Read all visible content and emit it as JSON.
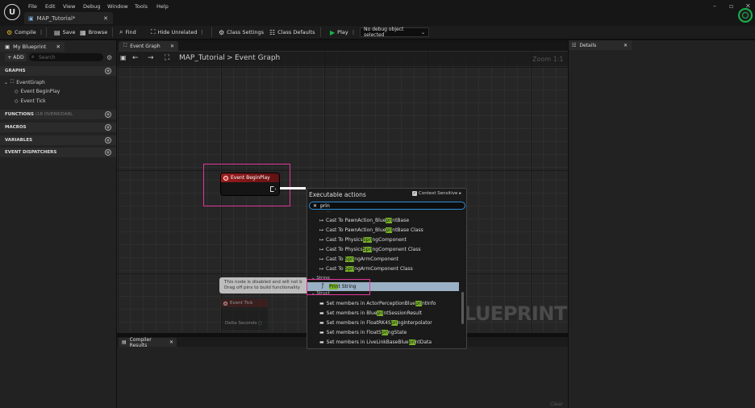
{
  "titlebar": {
    "menu": [
      "File",
      "Edit",
      "View",
      "Debug",
      "Window",
      "Tools",
      "Help"
    ],
    "doc_tab": "MAP_Tutorial*",
    "logo": "U"
  },
  "toolbar": {
    "compile": "Compile",
    "save": "Save",
    "browse": "Browse",
    "find": "Find",
    "hide_unrelated": "Hide Unrelated",
    "class_settings": "Class Settings",
    "class_defaults": "Class Defaults",
    "play": "Play",
    "debug_object": "No debug object selected"
  },
  "my_blueprint": {
    "tab": "My Blueprint",
    "add": "+ ADD",
    "search_placeholder": "Search",
    "graphs": "GRAPHS",
    "event_graph": "EventGraph",
    "event_begin_play": "Event BeginPlay",
    "event_tick": "Event Tick",
    "functions": "FUNCTIONS",
    "functions_overridable": "(18 OVERRIDABL",
    "macros": "MACROS",
    "variables": "VARIABLES",
    "event_dispatchers": "EVENT DISPATCHERS"
  },
  "graph": {
    "tab": "Event Graph",
    "crumb_root": "MAP_Tutorial",
    "crumb_sep": ">",
    "crumb_current": "Event Graph",
    "zoom": "Zoom 1:1",
    "watermark": "LUEPRINT",
    "begin_node": "Event BeginPlay",
    "tick_node": "Event Tick",
    "delta_seconds": "Delta Seconds",
    "disabled_line1": "This node is disabled and will not b",
    "disabled_line2": "Drag off pins to build functionality"
  },
  "action_menu": {
    "title": "Executable actions",
    "context_sensitive": "Context Sensitive",
    "search_value": "prin",
    "items_pre": [
      {
        "a": "Cast To PawnAction_Blue",
        "h": "pri",
        "b": "ntBase"
      },
      {
        "a": "Cast To PawnAction_Blue",
        "h": "pri",
        "b": "ntBase Class"
      },
      {
        "a": "Cast To Physics",
        "h": "Spri",
        "b": "ngComponent"
      },
      {
        "a": "Cast To Physics",
        "h": "Spri",
        "b": "ngComponent Class"
      },
      {
        "a": "Cast To ",
        "h": "Spri",
        "b": "ngArmComponent"
      },
      {
        "a": "Cast To ",
        "h": "Spri",
        "b": "ngArmComponent Class"
      }
    ],
    "category_string": "String",
    "print_pre": "",
    "print_hl": "Prin",
    "print_post": "t String",
    "category_struct": "Struct",
    "items_post": [
      {
        "a": "Set members in ActorPerceptionBlue",
        "h": "pri",
        "b": "ntInfo"
      },
      {
        "a": "Set members in Blue",
        "h": "pri",
        "b": "ntSessionResult"
      },
      {
        "a": "Set members in FloatRK4S",
        "h": "pri",
        "b": "ngInterpolator"
      },
      {
        "a": "Set members in FloatS",
        "h": "pri",
        "b": "ngState"
      },
      {
        "a": "Set members in LiveLinkBaseBlue",
        "h": "pri",
        "b": "ntData"
      }
    ]
  },
  "compiler": {
    "tab": "Compiler Results",
    "clear": "Clear"
  },
  "details": {
    "tab": "Details"
  },
  "colors": {
    "accent_pink": "#e0379a",
    "match_highlight": "#78b428",
    "play_green": "#19b34b",
    "node_red": "#9b1c1c"
  }
}
